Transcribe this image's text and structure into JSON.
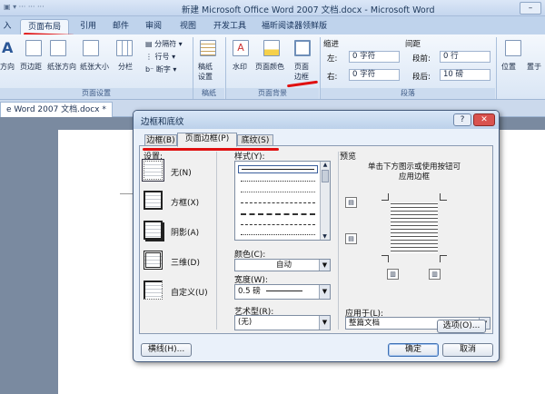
{
  "window": {
    "title": "新建 Microsoft Office Word 2007 文档.docx - Microsoft Word",
    "minimize": "–"
  },
  "ribbon_tabs": [
    {
      "label": "入"
    },
    {
      "label": "页面布局",
      "active": true
    },
    {
      "label": "引用"
    },
    {
      "label": "邮件"
    },
    {
      "label": "审阅"
    },
    {
      "label": "视图"
    },
    {
      "label": "开发工具"
    },
    {
      "label": "福昕阅读器领鲜版"
    }
  ],
  "ribbon": {
    "page_setup": {
      "buttons": [
        "方向",
        "页边距",
        "纸张方向",
        "纸张大小",
        "分栏"
      ],
      "small": [
        "分隔符",
        "行号",
        "断字"
      ],
      "group_label": "页面设置"
    },
    "draft": {
      "button": "稿纸设置",
      "line1": "稿纸",
      "line2": "设置",
      "group_label": "稿纸"
    },
    "page_background": {
      "buttons": [
        "水印",
        "页面颜色"
      ],
      "border_line1": "页面",
      "border_line2": "边框",
      "group_label": "页面背景"
    },
    "paragraph": {
      "indent_label": "缩进",
      "spacing_label": "间距",
      "left_label": "左:",
      "left_value": "0 字符",
      "right_label": "右:",
      "right_value": "0 字符",
      "before_label": "段前:",
      "before_value": "0 行",
      "after_label": "段后:",
      "after_value": "10 磅",
      "group_label": "段落"
    },
    "arrange": {
      "position": "位置",
      "front": "置于"
    }
  },
  "doc_tab": {
    "label": "e Word 2007 文档.docx *"
  },
  "dialog": {
    "title": "边框和底纹",
    "help": "?",
    "close": "✕",
    "tabs": [
      {
        "label": "边框(B)"
      },
      {
        "label": "页面边框(P)",
        "active": true
      },
      {
        "label": "底纹(S)"
      }
    ],
    "setting_label": "设置:",
    "settings": [
      {
        "label": "无(N)",
        "selected": true
      },
      {
        "label": "方框(X)"
      },
      {
        "label": "阴影(A)"
      },
      {
        "label": "三维(D)"
      },
      {
        "label": "自定义(U)"
      }
    ],
    "style_label": "样式(Y):",
    "color_label": "颜色(C):",
    "color_value": "自动",
    "width_label": "宽度(W):",
    "width_value": "0.5 磅",
    "art_label": "艺术型(R):",
    "art_value": "(无)",
    "preview_label": "预览",
    "preview_hint": "单击下方图示或使用按钮可应用边框",
    "apply_label": "应用于(L):",
    "apply_value": "整篇文档",
    "options_button": "选项(O)...",
    "hline_button": "横线(H)...",
    "ok_button": "确定",
    "cancel_button": "取消"
  }
}
